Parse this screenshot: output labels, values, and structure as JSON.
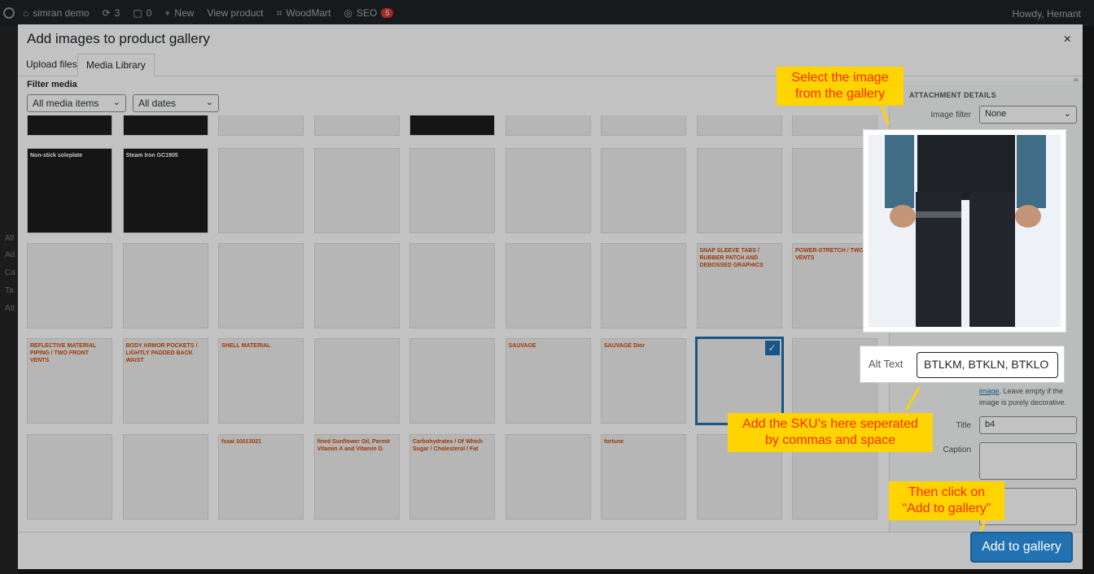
{
  "adminbar": {
    "site": "simran demo",
    "updates": "3",
    "comments": "0",
    "new": "New",
    "view": "View product",
    "woodmart": "WoodMart",
    "seo": "SEO",
    "seo_badge": "5",
    "howdy": "Howdy, Hemant"
  },
  "leftmenu": [
    "All",
    "Ad",
    "Ca",
    "Ta",
    "Att"
  ],
  "modal": {
    "title": "Add images to product gallery",
    "close": "×",
    "tabs": [
      "Upload files",
      "Media Library"
    ],
    "filter_label": "Filter media",
    "filter_type": "All media items",
    "filter_date": "All dates"
  },
  "grid": {
    "tiles": [
      {
        "label": "",
        "dark": true
      },
      {
        "label": "",
        "dark": true
      },
      {
        "label": "",
        "dark": false
      },
      {
        "label": "",
        "dark": false
      },
      {
        "label": "",
        "dark": true
      },
      {
        "label": "",
        "dark": false
      },
      {
        "label": "",
        "dark": false
      },
      {
        "label": "",
        "dark": false
      },
      {
        "label": "",
        "dark": false
      },
      {
        "label": "Non-stick soleplate",
        "dark": true
      },
      {
        "label": "Steam Iron GC1905",
        "dark": true
      },
      {
        "label": "",
        "dark": false
      },
      {
        "label": "",
        "dark": false
      },
      {
        "label": "",
        "dark": false
      },
      {
        "label": "",
        "dark": false
      },
      {
        "label": "",
        "dark": false
      },
      {
        "label": "",
        "dark": false
      },
      {
        "label": "",
        "dark": false
      },
      {
        "label": "",
        "dark": false
      },
      {
        "label": "",
        "dark": false
      },
      {
        "label": "",
        "dark": false
      },
      {
        "label": "",
        "dark": false
      },
      {
        "label": "",
        "dark": false
      },
      {
        "label": "",
        "dark": false
      },
      {
        "label": "",
        "dark": false
      },
      {
        "label": "SNAP SLEEVE TABS / RUBBER PATCH AND DEBOSSED GRAPHICS",
        "dark": false
      },
      {
        "label": "POWER-STRETCH / TWO VENTS",
        "dark": false
      },
      {
        "label": "REFLECTIVE MATERIAL PIPING / TWO FRONT VENTS",
        "dark": false
      },
      {
        "label": "BODY ARMOR POCKETS / LIGHTLY PADDED BACK WAIST",
        "dark": false
      },
      {
        "label": "SHELL MATERIAL",
        "dark": false
      },
      {
        "label": "",
        "dark": false
      },
      {
        "label": "",
        "dark": false
      },
      {
        "label": "SAUVAGE",
        "dark": false
      },
      {
        "label": "SAUVAGE Dior",
        "dark": false
      },
      {
        "label": "",
        "dark": false
      },
      {
        "label": "",
        "dark": false
      },
      {
        "label": "",
        "dark": false
      },
      {
        "label": "",
        "dark": false
      },
      {
        "label": "fssai 10013021",
        "dark": false
      },
      {
        "label": "fined Sunflower Oil, Permit Vitamin A and Vitamin D.",
        "dark": false
      },
      {
        "label": "Carbohydrates / Of Which Sugar / Cholesterol / Fat",
        "dark": false
      },
      {
        "label": "",
        "dark": false
      },
      {
        "label": "fortune",
        "dark": false
      },
      {
        "label": "",
        "dark": false
      },
      {
        "label": "",
        "dark": false
      }
    ]
  },
  "sidebar": {
    "heading": "ATTACHMENT DETAILS",
    "image_filter_label": "Image filter",
    "image_filter_value": "None",
    "alt_help_link": "image",
    "alt_help_text": ". Leave empty if the image is purely decorative.",
    "title_label": "Title",
    "title_value": "b4",
    "caption_label": "Caption"
  },
  "alt": {
    "label": "Alt Text",
    "value": "BTLKM, BTKLN, BTKLO"
  },
  "callouts": {
    "select": "Select the image from the gallery",
    "sku": "Add the SKU’s here seperated by commas and space",
    "then": "Then click on “Add to gallery”"
  },
  "button": {
    "add": "Add to gallery"
  },
  "colors": {
    "accent": "#2271b1",
    "callout_bg": "#ffd400",
    "callout_text": "#ff2a00"
  }
}
